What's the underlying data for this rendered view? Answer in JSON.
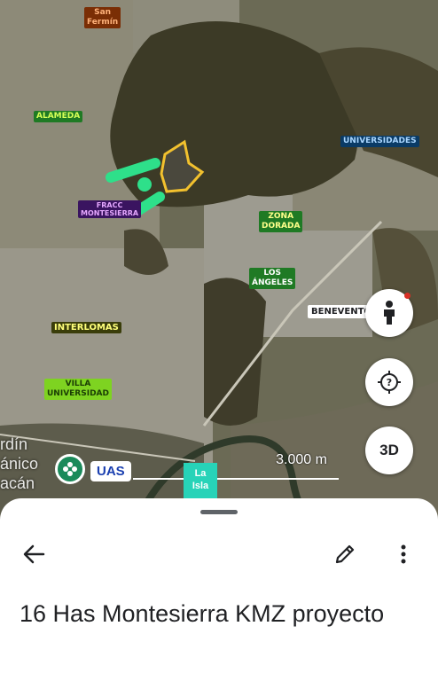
{
  "map": {
    "labels": {
      "san_fermin": "San\nFermín",
      "alameda": "ALAMEDA",
      "universidades": "UNIVERSIDADES",
      "fracc_montesierra": "FRACC\nMONTESIERRA",
      "zona_dorada": "ZONA\nDORADA",
      "los_angeles": "LOS\nÁNGELES",
      "benevento": "BENEVENTO",
      "interlomas": "INTERLOMAS",
      "villa_universidad": "VILLA\nUNIVERSIDAD",
      "uas": "UAS",
      "la_isla": "La\nIsla",
      "jardin": "rdín\nánico\nacán"
    },
    "scale": "3.000 m",
    "buttons": {
      "street_view": "street-view-pegman",
      "help": "?",
      "three_d": "3D"
    },
    "colors": {
      "polygon_outline": "#f2c12e",
      "route_green": "#2ee08a"
    }
  },
  "sheet": {
    "title": "16 Has Montesierra KMZ proyecto",
    "back_icon": "arrow-back-icon",
    "edit_icon": "pencil-icon",
    "more_icon": "more-vert-icon"
  }
}
